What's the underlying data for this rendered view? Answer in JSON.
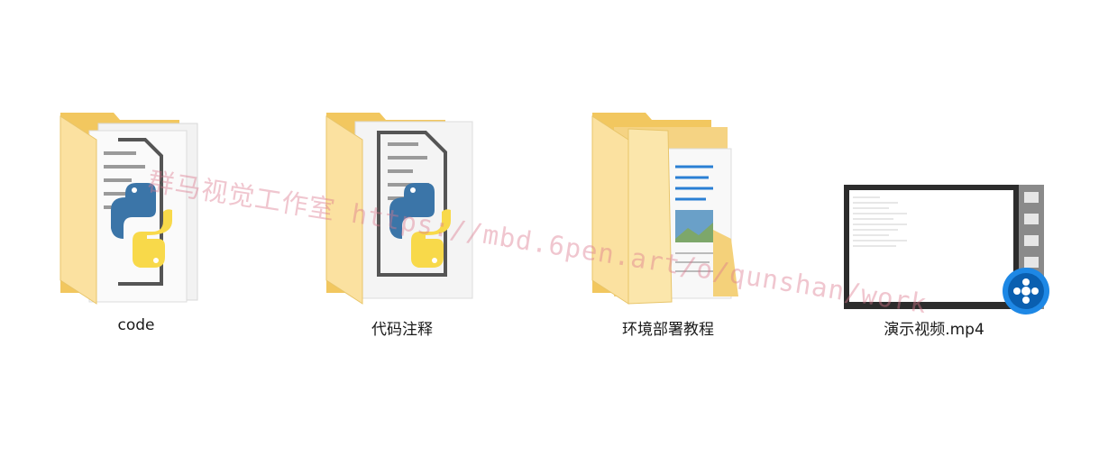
{
  "items": [
    {
      "label": "code",
      "icon": "python-folder-icon"
    },
    {
      "label": "代码注释",
      "icon": "python-folder-icon"
    },
    {
      "label": "环境部署教程",
      "icon": "document-folder-icon"
    },
    {
      "label": "演示视频.mp4",
      "icon": "video-file-icon"
    }
  ],
  "watermark": "群马视觉工作室 https://mbd.6pen.art/o/qunshan/work",
  "colors": {
    "folder_back": "#f0c45a",
    "folder_front": "#fbe39a",
    "python_blue": "#3b75a8",
    "python_yellow": "#f8d94a",
    "film_gray": "#8a8a8a",
    "player_blue": "#1e88e5",
    "watermark": "#dc788c"
  }
}
